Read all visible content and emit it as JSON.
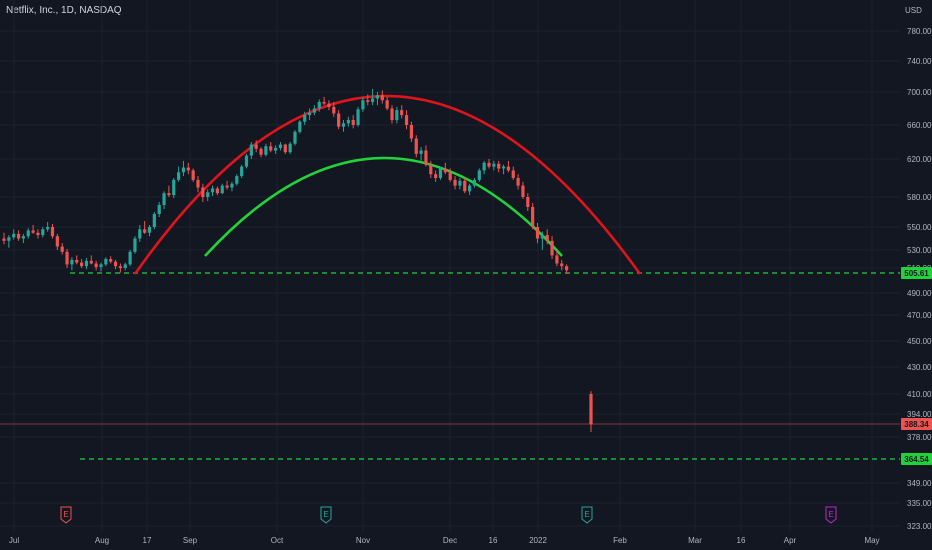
{
  "header": {
    "symbol_label": "Netflix, Inc., 1D, NASDAQ",
    "currency": "USD"
  },
  "chart_data": {
    "type": "candlestick",
    "title": "Netflix, Inc., 1D, NASDAQ",
    "currency": "USD",
    "price_axis": {
      "side": "right",
      "ticks": [
        "780.00",
        "740.00",
        "700.00",
        "660.00",
        "620.00",
        "580.00",
        "550.00",
        "530.00",
        "510.00",
        "490.00",
        "470.00",
        "450.00",
        "430.00",
        "410.00",
        "394.00",
        "378.00",
        "349.00",
        "335.00",
        "323.00"
      ],
      "range": [
        318,
        810
      ]
    },
    "time_axis": {
      "ticks": [
        "Jul",
        "Aug",
        "17",
        "Sep",
        "Oct",
        "Nov",
        "Dec",
        "16",
        "2022",
        "Feb",
        "Mar",
        "16",
        "Apr",
        "May"
      ]
    },
    "candles": [
      [
        540,
        545,
        535,
        538
      ],
      [
        538,
        543,
        532,
        541
      ],
      [
        541,
        548,
        539,
        544
      ],
      [
        544,
        547,
        538,
        540
      ],
      [
        540,
        544,
        536,
        542
      ],
      [
        542,
        549,
        540,
        547
      ],
      [
        547,
        552,
        544,
        545
      ],
      [
        545,
        548,
        540,
        543
      ],
      [
        543,
        550,
        541,
        548
      ],
      [
        548,
        555,
        546,
        550
      ],
      [
        550,
        553,
        540,
        542
      ],
      [
        542,
        544,
        530,
        533
      ],
      [
        533,
        536,
        525,
        528
      ],
      [
        528,
        531,
        510,
        514
      ],
      [
        514,
        522,
        508,
        519
      ],
      [
        519,
        524,
        514,
        516
      ],
      [
        516,
        520,
        510,
        512
      ],
      [
        512,
        521,
        509,
        518
      ],
      [
        518,
        524,
        514,
        515
      ],
      [
        515,
        518,
        508,
        511
      ],
      [
        511,
        516,
        507,
        514
      ],
      [
        514,
        522,
        512,
        520
      ],
      [
        520,
        523,
        515,
        517
      ],
      [
        517,
        519,
        509,
        512
      ],
      [
        512,
        515,
        506,
        510
      ],
      [
        510,
        516,
        508,
        514
      ],
      [
        514,
        530,
        512,
        528
      ],
      [
        528,
        542,
        526,
        540
      ],
      [
        540,
        552,
        537,
        548
      ],
      [
        548,
        556,
        544,
        545
      ],
      [
        545,
        552,
        542,
        550
      ],
      [
        550,
        565,
        548,
        563
      ],
      [
        563,
        575,
        560,
        572
      ],
      [
        572,
        586,
        568,
        584
      ],
      [
        584,
        592,
        580,
        582
      ],
      [
        582,
        600,
        579,
        598
      ],
      [
        598,
        612,
        596,
        606
      ],
      [
        606,
        618,
        602,
        611
      ],
      [
        611,
        616,
        604,
        608
      ],
      [
        608,
        610,
        596,
        598
      ],
      [
        598,
        602,
        585,
        590
      ],
      [
        590,
        594,
        575,
        580
      ],
      [
        580,
        588,
        576,
        585
      ],
      [
        585,
        592,
        581,
        589
      ],
      [
        589,
        591,
        582,
        584
      ],
      [
        584,
        594,
        583,
        592
      ],
      [
        592,
        597,
        588,
        590
      ],
      [
        590,
        596,
        586,
        594
      ],
      [
        594,
        604,
        592,
        602
      ],
      [
        602,
        614,
        600,
        612
      ],
      [
        612,
        626,
        610,
        624
      ],
      [
        624,
        640,
        620,
        637
      ],
      [
        637,
        642,
        628,
        632
      ],
      [
        632,
        634,
        622,
        625
      ],
      [
        625,
        638,
        623,
        635
      ],
      [
        635,
        640,
        628,
        630
      ],
      [
        630,
        636,
        626,
        633
      ],
      [
        633,
        640,
        630,
        637
      ],
      [
        637,
        638,
        626,
        628
      ],
      [
        628,
        640,
        626,
        638
      ],
      [
        638,
        654,
        636,
        652
      ],
      [
        652,
        666,
        650,
        664
      ],
      [
        664,
        676,
        660,
        672
      ],
      [
        672,
        680,
        666,
        675
      ],
      [
        675,
        684,
        672,
        680
      ],
      [
        680,
        691,
        676,
        688
      ],
      [
        688,
        694,
        684,
        686
      ],
      [
        686,
        690,
        678,
        682
      ],
      [
        682,
        688,
        670,
        674
      ],
      [
        674,
        678,
        655,
        658
      ],
      [
        658,
        666,
        652,
        662
      ],
      [
        662,
        670,
        658,
        666
      ],
      [
        666,
        672,
        656,
        660
      ],
      [
        660,
        682,
        658,
        679
      ],
      [
        679,
        694,
        676,
        690
      ],
      [
        690,
        697,
        684,
        688
      ],
      [
        688,
        704,
        684,
        692
      ],
      [
        692,
        700,
        684,
        696
      ],
      [
        696,
        702,
        686,
        690
      ],
      [
        690,
        694,
        678,
        680
      ],
      [
        680,
        684,
        662,
        666
      ],
      [
        666,
        682,
        662,
        678
      ],
      [
        678,
        684,
        668,
        672
      ],
      [
        672,
        678,
        655,
        660
      ],
      [
        660,
        664,
        640,
        644
      ],
      [
        644,
        648,
        622,
        626
      ],
      [
        626,
        634,
        618,
        630
      ],
      [
        630,
        636,
        612,
        614
      ],
      [
        614,
        618,
        600,
        604
      ],
      [
        604,
        608,
        596,
        600
      ],
      [
        600,
        612,
        598,
        610
      ],
      [
        610,
        616,
        604,
        606
      ],
      [
        606,
        610,
        596,
        598
      ],
      [
        598,
        602,
        588,
        592
      ],
      [
        592,
        600,
        588,
        597
      ],
      [
        597,
        600,
        584,
        586
      ],
      [
        586,
        594,
        582,
        592
      ],
      [
        592,
        600,
        590,
        598
      ],
      [
        598,
        610,
        596,
        608
      ],
      [
        608,
        618,
        604,
        616
      ],
      [
        616,
        620,
        610,
        612
      ],
      [
        612,
        618,
        608,
        615
      ],
      [
        615,
        618,
        606,
        610
      ],
      [
        610,
        614,
        604,
        612
      ],
      [
        612,
        618,
        606,
        608
      ],
      [
        608,
        612,
        598,
        600
      ],
      [
        600,
        604,
        588,
        592
      ],
      [
        592,
        596,
        578,
        580
      ],
      [
        580,
        584,
        566,
        570
      ],
      [
        570,
        574,
        548,
        550
      ],
      [
        550,
        554,
        536,
        540
      ],
      [
        540,
        546,
        530,
        543
      ],
      [
        543,
        548,
        535,
        538
      ],
      [
        538,
        542,
        520,
        524
      ],
      [
        524,
        530,
        512,
        515
      ],
      [
        515,
        519,
        508,
        512
      ],
      [
        512,
        514,
        505,
        508
      ],
      [
        410,
        412,
        382,
        388
      ]
    ],
    "horizontal_levels": [
      {
        "value": 505.61,
        "label": "505.61",
        "color": "#22d23a",
        "style": "dashed"
      },
      {
        "value": 388.34,
        "label": "388.34",
        "color": "#ef5350",
        "style": "solid-thin"
      },
      {
        "value": 364.54,
        "label": "364.54",
        "color": "#22d23a",
        "style": "dashed"
      }
    ],
    "arcs": [
      {
        "color": "#e0141b",
        "role": "upper"
      },
      {
        "color": "#22d23a",
        "role": "lower"
      }
    ],
    "events": [
      {
        "label": "E",
        "color": "#ef5350"
      },
      {
        "label": "E",
        "color": "#26a69a"
      },
      {
        "label": "E",
        "color": "#26a69a"
      },
      {
        "label": "E",
        "color": "#c026d3"
      }
    ],
    "colors": {
      "up": "#26a69a",
      "down": "#ef5350",
      "background": "#131722",
      "grid": "#1e222d"
    },
    "grid": true
  }
}
